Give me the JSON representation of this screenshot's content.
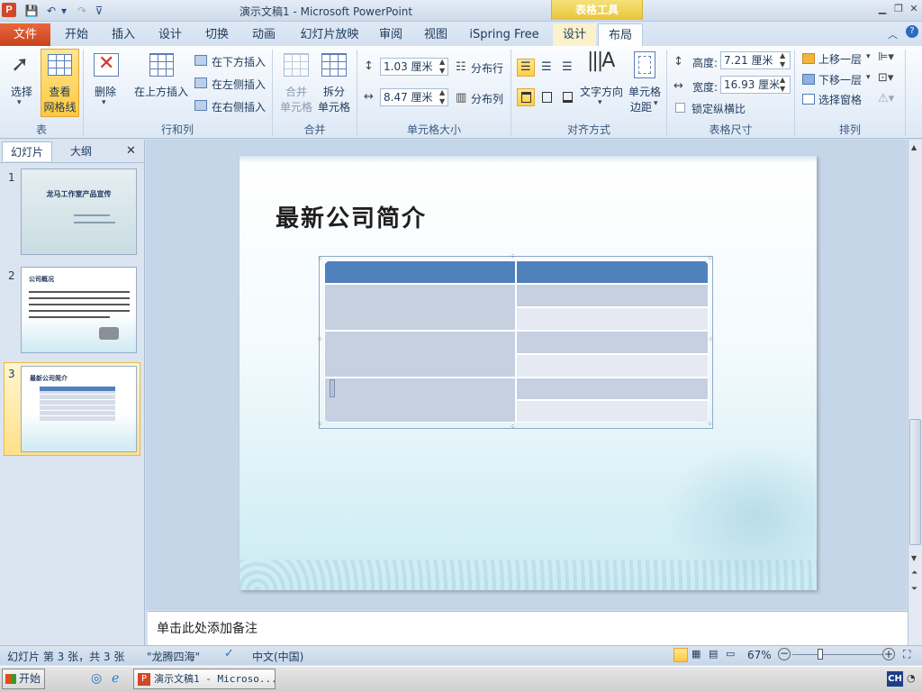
{
  "window": {
    "title": "演示文稿1 - Microsoft PowerPoint",
    "context_group": "表格工具"
  },
  "tabs": {
    "file": "文件",
    "home": "开始",
    "insert": "插入",
    "design": "设计",
    "transitions": "切换",
    "animations": "动画",
    "slideshow": "幻灯片放映",
    "review": "审阅",
    "view": "视图",
    "ispring": "iSpring Free",
    "table_design": "设计",
    "layout": "布局"
  },
  "ribbon": {
    "table_group": {
      "select": "选择",
      "gridlines_1": "查看",
      "gridlines_2": "网格线",
      "label": "表"
    },
    "rowscols_group": {
      "delete": "删除",
      "insert_above": "在上方插入",
      "insert_below": "在下方插入",
      "insert_left": "在左侧插入",
      "insert_right": "在右侧插入",
      "label": "行和列"
    },
    "merge_group": {
      "merge_1": "合并",
      "merge_2": "单元格",
      "split_1": "拆分",
      "split_2": "单元格",
      "label": "合并"
    },
    "cellsize_group": {
      "height_value": "1.03 厘米",
      "width_value": "8.47 厘米",
      "distribute_rows": "分布行",
      "distribute_cols": "分布列",
      "label": "单元格大小"
    },
    "alignment_group": {
      "text_direction": "文字方向",
      "cell_margins_1": "单元格",
      "cell_margins_2": "边距",
      "label": "对齐方式"
    },
    "tablesize_group": {
      "height_label": "高度:",
      "height_value": "7.21 厘米",
      "width_label": "宽度:",
      "width_value": "16.93 厘米",
      "lock_ratio": "锁定纵横比",
      "label": "表格尺寸"
    },
    "arrange_group": {
      "bring_forward": "上移一层",
      "send_backward": "下移一层",
      "selection_pane": "选择窗格",
      "label": "排列"
    }
  },
  "left_pane": {
    "tab_slides": "幻灯片",
    "tab_outline": "大纲",
    "close": "✕"
  },
  "thumbnails": [
    {
      "num": "1",
      "title": "龙马工作室产品宣传"
    },
    {
      "num": "2",
      "title": "公司概况"
    },
    {
      "num": "3",
      "title": "最新公司简介"
    }
  ],
  "slide": {
    "title": "最新公司简介"
  },
  "notes": {
    "placeholder": "单击此处添加备注"
  },
  "status": {
    "slide_info": "幻灯片 第 3 张，共 3 张",
    "theme": "\"龙腾四海\"",
    "language": "中文(中国)",
    "zoom": "67%"
  },
  "taskbar": {
    "start": "开始",
    "window": "演示文稿1 - Microso...",
    "ime": "CH"
  },
  "colors": {
    "table_header": "#4f81bd",
    "table_dark": "#c5d0e1",
    "table_light": "#e4e9f2",
    "accent_file": "#d24726"
  }
}
